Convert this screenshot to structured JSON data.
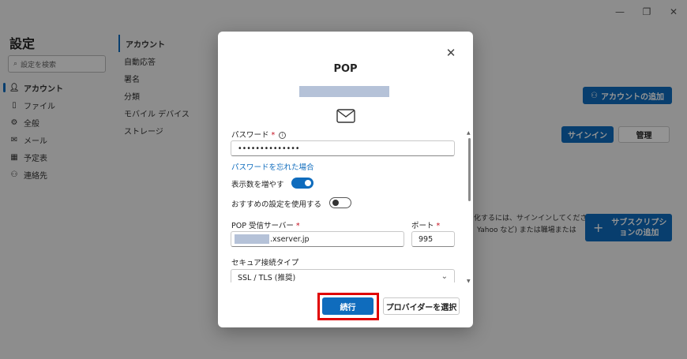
{
  "window": {
    "minimize": "—",
    "restore": "❐",
    "close": "✕"
  },
  "app": {
    "title": "設定",
    "search_placeholder": "設定を検索",
    "nav": [
      {
        "label": "アカウント",
        "icon": "person-icon"
      },
      {
        "label": "ファイル",
        "icon": "file-icon"
      },
      {
        "label": "全般",
        "icon": "gear-icon"
      },
      {
        "label": "メール",
        "icon": "mail-icon"
      },
      {
        "label": "予定表",
        "icon": "calendar-icon"
      },
      {
        "label": "連絡先",
        "icon": "contacts-icon"
      }
    ],
    "subnav": [
      "アカウント",
      "自動応答",
      "署名",
      "分類",
      "モバイル デバイス",
      "ストレージ"
    ],
    "add_account": "アカウントの追加",
    "sign_in": "サインイン",
    "manage": "管理",
    "sub_text_1": "化するには、サインインしてくださ",
    "sub_text_2": "Yahoo など) または職場または",
    "add_subscription_1": "サブスクリプシ",
    "add_subscription_2": "ョンの追加"
  },
  "dialog": {
    "title": "POP",
    "close": "✕",
    "password_label": "パスワード",
    "required_mark": "*",
    "password_value": "••••••••••••••",
    "forgot_password": "パスワードを忘れた場合",
    "show_more_label": "表示数を増やす",
    "show_more_on": true,
    "recommended_label": "おすすめの設定を使用する",
    "recommended_on": false,
    "pop_server_label": "POP 受信サーバー",
    "pop_server_value": ".xserver.jp",
    "port_label": "ポート",
    "port_value": "995",
    "secure_type_label": "セキュア接続タイプ",
    "secure_type_value": "SSL / TLS (推奨)",
    "continue_button": "続行",
    "provider_button": "プロバイダーを選択"
  }
}
